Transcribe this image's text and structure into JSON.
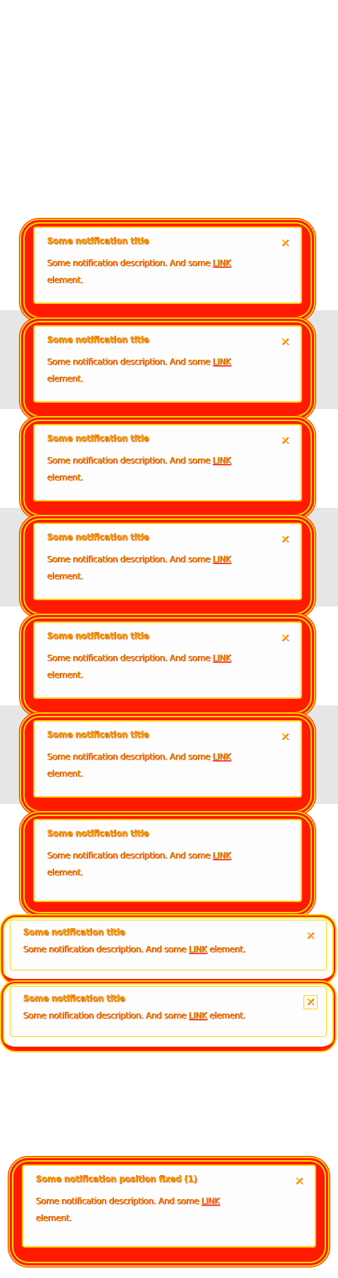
{
  "notifications": [
    {
      "title": "Some notification title",
      "desc_text": "Some notification description. And some ",
      "link_text": "LINK",
      "desc_rest": "element.",
      "close_icon": "✕"
    },
    {
      "title": "Some notification title",
      "desc_text": "Some notification description. And some ",
      "link_text": "LINK",
      "desc_rest": "element.",
      "close_icon": "✕"
    },
    {
      "title": "Some notification title",
      "desc_text": "Some notification description. And some ",
      "link_text": "LINK",
      "desc_rest": "element.",
      "close_icon": "✕"
    },
    {
      "title": "Some notification title",
      "desc_text": "Some notification description. And some ",
      "link_text": "LINK",
      "desc_rest": "element.",
      "close_icon": "✕"
    },
    {
      "title": "Some notification title",
      "desc_text": "Some notification description. And some ",
      "link_text": "LINK",
      "desc_rest": "element.",
      "close_icon": "✕"
    },
    {
      "title": "Some notification title",
      "desc_text": "Some notification description. And some ",
      "link_text": "LINK",
      "desc_rest": "element.",
      "close_icon": "✕"
    },
    {
      "title": "Some notification title",
      "desc_text": "Some notification description. And some ",
      "link_text": "LINK",
      "desc_rest": "element."
    },
    {
      "title": "Some notification title",
      "desc_text": "Some notification description. And some ",
      "link_text": "LINK",
      "desc_rest": " element.",
      "close_icon": "✕"
    },
    {
      "title": "Some notification title",
      "desc_text": "Some notification description. And some ",
      "link_text": "LINK",
      "desc_rest": " element.",
      "close_icon": "✕"
    },
    {
      "title": "Some notification position fixed (1)",
      "desc_text": "Some notification description. And some ",
      "link_text": "LINK",
      "desc_rest": "element.",
      "close_icon": "✕"
    }
  ],
  "colors": {
    "frame_red": "#ff1a00",
    "accent_yellow": "#ffd400",
    "text_gold": "#d19a00",
    "band_gray": "#e6e6e6"
  }
}
